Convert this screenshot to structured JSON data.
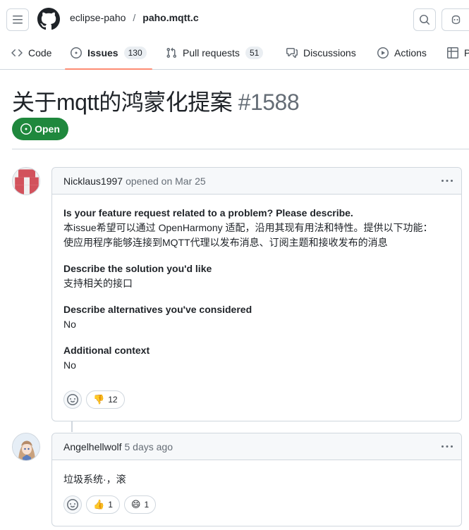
{
  "header": {
    "owner": "eclipse-paho",
    "separator": "/",
    "repo": "paho.mqtt.c"
  },
  "tabs": [
    {
      "label": "Code"
    },
    {
      "label": "Issues",
      "count": "130"
    },
    {
      "label": "Pull requests",
      "count": "51"
    },
    {
      "label": "Discussions"
    },
    {
      "label": "Actions"
    },
    {
      "label": "P"
    }
  ],
  "issue": {
    "title": "关于mqtt的鸿蒙化提案",
    "number": "#1588",
    "state": "Open"
  },
  "comments": [
    {
      "author": "Nicklaus1997",
      "meta": "opened on Mar 25",
      "blocks": [
        {
          "heading": "Is your feature request related to a problem? Please describe.",
          "lines": [
            "本issue希望可以通过 OpenHarmony 适配，沿用其现有用法和特性。提供以下功能：",
            "使应用程序能够连接到MQTT代理以发布消息、订阅主题和接收发布的消息"
          ]
        },
        {
          "heading": "Describe the solution you'd like",
          "lines": [
            "支持相关的接口"
          ]
        },
        {
          "heading": "Describe alternatives you've considered",
          "lines": [
            "No"
          ]
        },
        {
          "heading": "Additional context",
          "lines": [
            "No"
          ]
        }
      ],
      "reactions": [
        {
          "emoji": "👎",
          "count": "12"
        }
      ]
    },
    {
      "author": "Angelhellwolf",
      "meta": "5 days ago",
      "text": "垃圾系统·，滚",
      "reactions": [
        {
          "emoji": "👍",
          "count": "1"
        },
        {
          "emoji": "😄",
          "count": "1"
        }
      ]
    }
  ],
  "colors": {
    "open_state": "#1f883d",
    "tab_underline": "#fd8c73",
    "border": "#d0d7de"
  }
}
